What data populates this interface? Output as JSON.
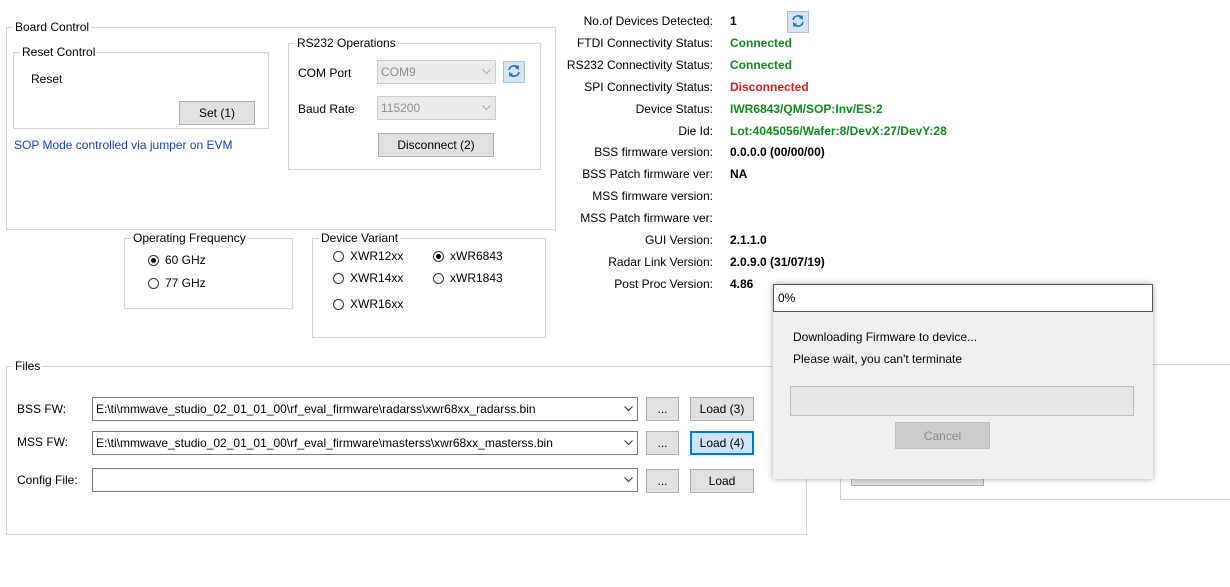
{
  "board_control": {
    "title": "Board Control",
    "reset_control": {
      "title": "Reset Control",
      "label": "Reset",
      "set_button": "Set (1)"
    },
    "sop_note": "SOP Mode controlled via jumper on EVM",
    "rs232": {
      "title": "RS232 Operations",
      "com_port_label": "COM Port",
      "com_port_value": "COM9",
      "baud_rate_label": "Baud Rate",
      "baud_rate_value": "115200",
      "disconnect_button": "Disconnect (2)"
    }
  },
  "status": [
    {
      "label": "No.of Devices Detected:",
      "value": "1",
      "color": "#000000"
    },
    {
      "label": "FTDI Connectivity Status:",
      "value": "Connected",
      "color": "#118a1e"
    },
    {
      "label": "RS232 Connectivity Status:",
      "value": "Connected",
      "color": "#118a1e"
    },
    {
      "label": "SPI Connectivity Status:",
      "value": "Disconnected",
      "color": "#e01b1b"
    },
    {
      "label": "Device Status:",
      "value": "IWR6843/QM/SOP:Inv/ES:2",
      "color": "#118a1e"
    },
    {
      "label": "Die Id:",
      "value": "Lot:4045056/Wafer:8/DevX:27/DevY:28",
      "color": "#118a1e"
    },
    {
      "label": "BSS firmware version:",
      "value": "0.0.0.0 (00/00/00)",
      "color": "#000000"
    },
    {
      "label": "BSS Patch firmware ver:",
      "value": "NA",
      "color": "#000000"
    },
    {
      "label": "MSS firmware version:",
      "value": "",
      "color": "#000000"
    },
    {
      "label": "MSS Patch firmware ver:",
      "value": "",
      "color": "#000000"
    },
    {
      "label": "GUI Version:",
      "value": "2.1.1.0",
      "color": "#000000"
    },
    {
      "label": "Radar Link Version:",
      "value": "2.0.9.0 (31/07/19)",
      "color": "#000000"
    },
    {
      "label": "Post Proc Version:",
      "value": "4.86",
      "color": "#000000"
    }
  ],
  "operating_frequency": {
    "title": "Operating Frequency",
    "options": [
      "60 GHz",
      "77 GHz"
    ],
    "selected": "60 GHz"
  },
  "device_variant": {
    "title": "Device Variant",
    "options": [
      "XWR12xx",
      "XWR14xx",
      "XWR16xx",
      "xWR6843",
      "xWR1843"
    ],
    "selected": "xWR6843"
  },
  "files": {
    "title": "Files",
    "bss_label": "BSS FW:",
    "bss_path": "E:\\ti\\mmwave_studio_02_01_01_00\\rf_eval_firmware\\radarss\\xwr68xx_radarss.bin",
    "bss_load": "Load (3)",
    "mss_label": "MSS FW:",
    "mss_path": "E:\\ti\\mmwave_studio_02_01_01_00\\rf_eval_firmware\\masterss\\xwr68xx_masterss.bin",
    "mss_load": "Load (4)",
    "config_label": "Config File:",
    "config_path": "",
    "config_load": "Load",
    "browse": "..."
  },
  "progress_dialog": {
    "title": "0%",
    "line1": "Downloading Firmware to device...",
    "line2": "Please wait, you can't terminate",
    "progress": 0,
    "cancel": "Cancel"
  }
}
